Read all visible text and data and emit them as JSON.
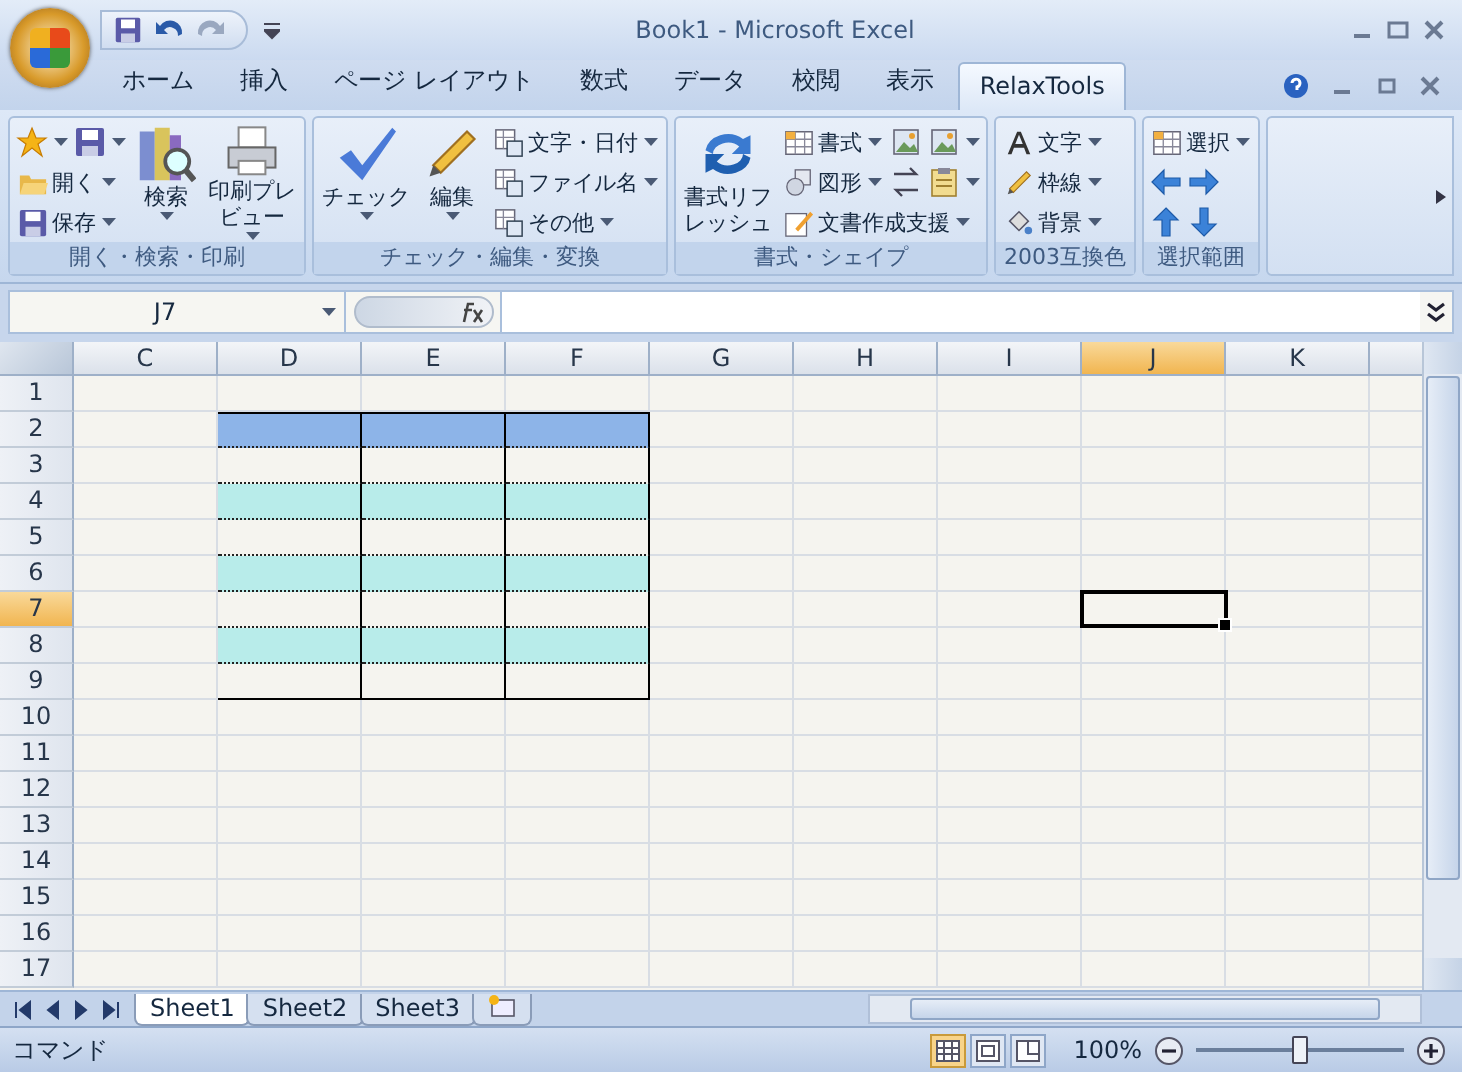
{
  "window": {
    "title": "Book1 - Microsoft Excel"
  },
  "ribbon_tabs": [
    {
      "label": "ホーム",
      "selected": false
    },
    {
      "label": "挿入",
      "selected": false
    },
    {
      "label": "ページ レイアウト",
      "selected": false
    },
    {
      "label": "数式",
      "selected": false
    },
    {
      "label": "データ",
      "selected": false
    },
    {
      "label": "校閲",
      "selected": false
    },
    {
      "label": "表示",
      "selected": false
    },
    {
      "label": "RelaxTools",
      "selected": true
    }
  ],
  "ribbon_groups": [
    {
      "label": "開く・検索・印刷",
      "columns": [
        {
          "rows": [
            [
              {
                "kind": "icon",
                "dropdown": true
              },
              {
                "kind": "icon",
                "dropdown": true
              }
            ],
            [
              {
                "kind": "small",
                "label": "開く",
                "dropdown": true
              }
            ],
            [
              {
                "kind": "small",
                "label": "保存",
                "dropdown": true
              }
            ]
          ]
        },
        {
          "rows": [
            [
              {
                "kind": "large",
                "lines": [
                  "検索"
                ],
                "dropdown": true
              }
            ]
          ]
        },
        {
          "rows": [
            [
              {
                "kind": "large",
                "lines": [
                  "印刷プレ",
                  "ビュー"
                ],
                "dropdown": true
              }
            ]
          ]
        }
      ]
    },
    {
      "label": "チェック・編集・変換",
      "columns": [
        {
          "rows": [
            [
              {
                "kind": "large",
                "lines": [
                  "チェック"
                ],
                "dropdown": true
              }
            ]
          ]
        },
        {
          "rows": [
            [
              {
                "kind": "large",
                "lines": [
                  "編集"
                ],
                "dropdown": true
              }
            ]
          ]
        },
        {
          "rows": [
            [
              {
                "kind": "small",
                "label": "文字・日付",
                "dropdown": true
              }
            ],
            [
              {
                "kind": "small",
                "label": "ファイル名",
                "dropdown": true
              }
            ],
            [
              {
                "kind": "small",
                "label": "その他",
                "dropdown": true
              }
            ]
          ]
        }
      ]
    },
    {
      "label": "書式・シェイプ",
      "columns": [
        {
          "rows": [
            [
              {
                "kind": "large",
                "lines": [
                  "書式リフ",
                  "レッシュ"
                ]
              }
            ]
          ]
        },
        {
          "rows": [
            [
              {
                "kind": "small",
                "label": "書式",
                "dropdown": true
              },
              {
                "kind": "icon"
              },
              {
                "kind": "icon",
                "dropdown": true
              }
            ],
            [
              {
                "kind": "small",
                "label": "図形",
                "dropdown": true
              },
              {
                "kind": "icon"
              },
              {
                "kind": "icon",
                "dropdown": true
              }
            ],
            [
              {
                "kind": "small",
                "label": "文書作成支援",
                "dropdown": true
              }
            ]
          ]
        }
      ]
    },
    {
      "label": "2003互換色",
      "columns": [
        {
          "rows": [
            [
              {
                "kind": "small",
                "label": "文字",
                "dropdown": true
              }
            ],
            [
              {
                "kind": "small",
                "label": "枠線",
                "dropdown": true
              }
            ],
            [
              {
                "kind": "small",
                "label": "背景",
                "dropdown": true
              }
            ]
          ]
        }
      ]
    },
    {
      "label": "選択範囲",
      "columns": [
        {
          "rows": [
            [
              {
                "kind": "small",
                "label": "選択",
                "dropdown": true
              }
            ],
            [
              {
                "kind": "icon"
              },
              {
                "kind": "icon"
              }
            ],
            [
              {
                "kind": "icon"
              },
              {
                "kind": "icon"
              }
            ]
          ]
        }
      ]
    }
  ],
  "name_box": {
    "value": "J7"
  },
  "grid": {
    "columns": [
      {
        "label": "C",
        "selected": false,
        "in_table": false
      },
      {
        "label": "D",
        "selected": false,
        "in_table": true
      },
      {
        "label": "E",
        "selected": false,
        "in_table": true
      },
      {
        "label": "F",
        "selected": false,
        "in_table": true
      },
      {
        "label": "G",
        "selected": false,
        "in_table": false
      },
      {
        "label": "H",
        "selected": false,
        "in_table": false
      },
      {
        "label": "I",
        "selected": false,
        "in_table": false
      },
      {
        "label": "J",
        "selected": true,
        "in_table": false
      },
      {
        "label": "K",
        "selected": false,
        "in_table": false
      }
    ],
    "rows": [
      {
        "label": "1",
        "selected": false
      },
      {
        "label": "2",
        "selected": false,
        "color": "#8db4e8"
      },
      {
        "label": "3",
        "selected": false,
        "color": "#f5f4ef"
      },
      {
        "label": "4",
        "selected": false,
        "color": "#b8ecea"
      },
      {
        "label": "5",
        "selected": false,
        "color": "#f5f4ef"
      },
      {
        "label": "6",
        "selected": false,
        "color": "#b8ecea"
      },
      {
        "label": "7",
        "selected": true,
        "color": "#f5f4ef"
      },
      {
        "label": "8",
        "selected": false,
        "color": "#b8ecea"
      },
      {
        "label": "9",
        "selected": false,
        "color": "#f5f4ef"
      },
      {
        "label": "10",
        "selected": false
      },
      {
        "label": "11",
        "selected": false
      },
      {
        "label": "12",
        "selected": false
      },
      {
        "label": "13",
        "selected": false
      },
      {
        "label": "14",
        "selected": false
      },
      {
        "label": "15",
        "selected": false
      },
      {
        "label": "16",
        "selected": false
      },
      {
        "label": "17",
        "selected": false
      }
    ]
  },
  "sheet_tabs": [
    {
      "label": "Sheet1",
      "selected": true
    },
    {
      "label": "Sheet2",
      "selected": false
    },
    {
      "label": "Sheet3",
      "selected": false
    }
  ],
  "status_bar": {
    "mode": "コマンド",
    "views": [
      {
        "selected": true
      },
      {
        "selected": false
      },
      {
        "selected": false
      }
    ],
    "zoom": "100%",
    "zoom_level": {
      "level": 0.5
    }
  }
}
